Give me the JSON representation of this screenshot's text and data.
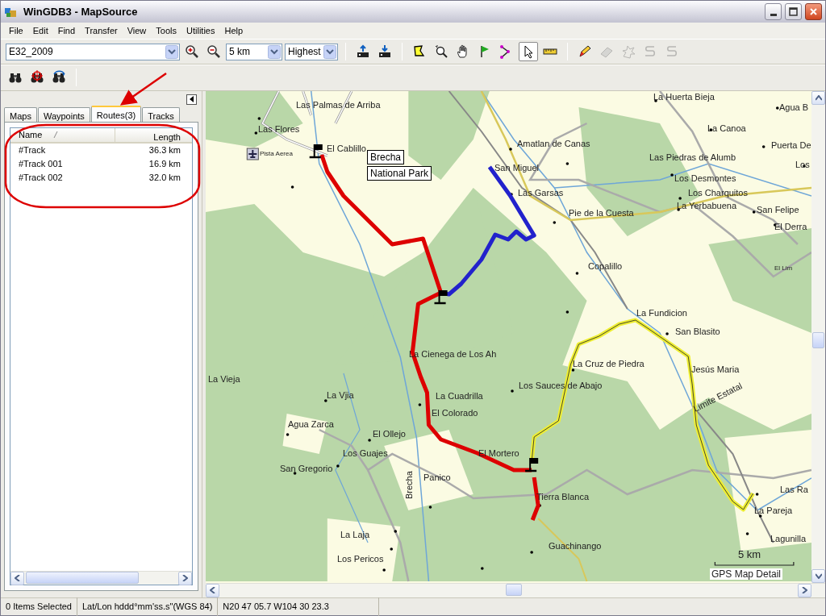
{
  "window": {
    "title": "WinGDB3 - MapSource"
  },
  "menu": [
    "File",
    "Edit",
    "Find",
    "Transfer",
    "View",
    "Tools",
    "Utilities",
    "Help"
  ],
  "toolbar": {
    "map_product": "E32_2009",
    "zoom_scale": "5 km",
    "detail": "Highest",
    "tools": [
      {
        "kind": "select-map",
        "selected": false,
        "disabled": false
      },
      {
        "kind": "zoom",
        "selected": false,
        "disabled": false
      },
      {
        "kind": "hand",
        "selected": false,
        "disabled": false
      },
      {
        "kind": "waypoint",
        "selected": false,
        "disabled": false
      },
      {
        "kind": "route",
        "selected": false,
        "disabled": false
      },
      {
        "kind": "pointer",
        "selected": true,
        "disabled": false
      },
      {
        "kind": "measure",
        "selected": false,
        "disabled": false
      },
      {
        "kind": "pencil",
        "selected": false,
        "disabled": false
      },
      {
        "kind": "eraser",
        "selected": false,
        "disabled": true
      },
      {
        "kind": "burst",
        "selected": false,
        "disabled": true
      },
      {
        "kind": "curve",
        "selected": false,
        "disabled": true
      },
      {
        "kind": "curve",
        "selected": false,
        "disabled": true
      }
    ]
  },
  "panel": {
    "tabs": [
      {
        "label": "Maps",
        "selected": false
      },
      {
        "label": "Waypoints",
        "selected": false
      },
      {
        "label": "Routes(3)",
        "selected": true
      },
      {
        "label": "Tracks",
        "selected": false
      }
    ],
    "columns": [
      "Name",
      "Length"
    ],
    "rows": [
      {
        "name": "#Track",
        "length": "36.3 km",
        "selected": false
      },
      {
        "name": "#Track 001",
        "length": "16.9 km",
        "selected": false
      },
      {
        "name": "#Track 002",
        "length": "32.0 km",
        "selected": false
      }
    ]
  },
  "map": {
    "labels": [
      "Las Palmas de Arriba",
      "Las Flores",
      "Pista Aerea",
      "El Cablillo",
      "Amatlan de Canas",
      "San Miguel",
      "Las Garsas",
      "Pie de la Cuesta",
      "La Huerta Bieja",
      "Agua B",
      "La Canoa",
      "Puerta De",
      "Las Piedras de Alumb",
      "Los",
      "Los Desmontes",
      "Los Charquitos",
      "La Yerbabuena",
      "San Felipe",
      "El Derra",
      "El Lim",
      "Copalillo",
      "La Fundicion",
      "San Blasito",
      "La Cruz de Piedra",
      "Jesús Maria",
      "Limite Estatal",
      "Los Sauces de Abajo",
      "La Vieja",
      "La Vjia",
      "Agua Zarca",
      "El Ollejo",
      "La Cienega de Los Ah",
      "La Cuadrilla",
      "El Colorado",
      "Los Guajes",
      "San Gregorio",
      "El Mortero",
      "Panico",
      "Brecha",
      "Tierra Blanca",
      "La Laja",
      "Los Pericos",
      "Guachinango",
      "Las Ra",
      "La Pareja",
      "Lagunilla"
    ],
    "callouts": [
      "Brecha",
      "National Park"
    ],
    "scale": "5 km",
    "caption": "GPS Map Detail"
  },
  "status_bar": [
    "0 Items Selected",
    "Lat/Lon hddd°mm'ss.s\"(WGS 84)",
    "N20 47 05.7 W104 30 23.3"
  ]
}
